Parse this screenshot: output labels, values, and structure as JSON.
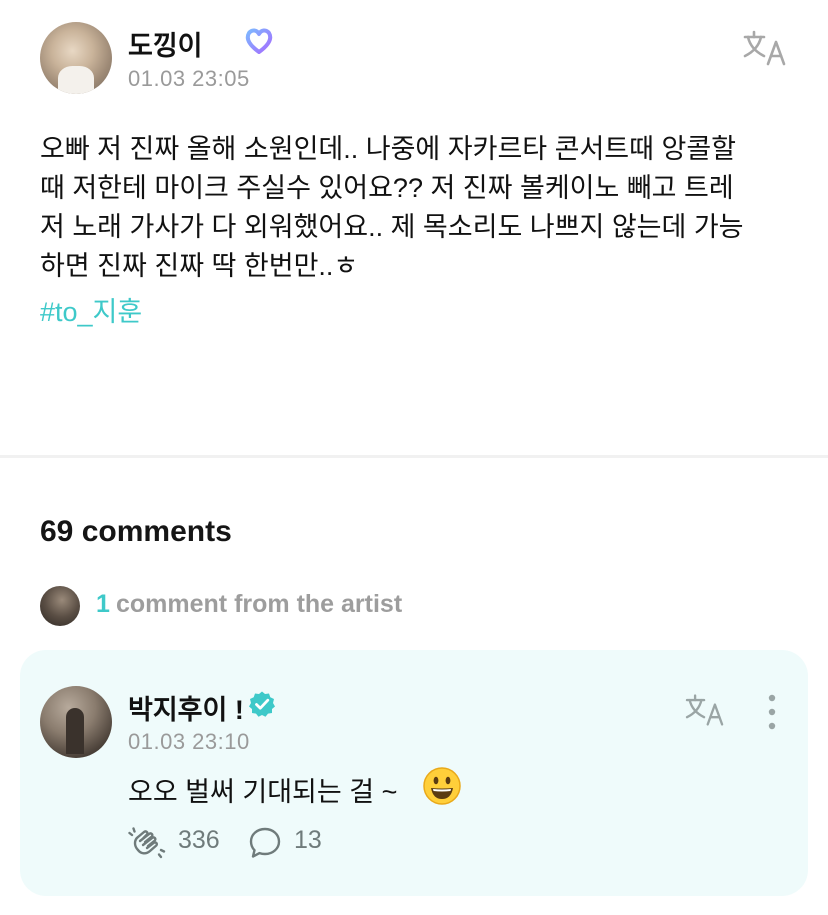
{
  "post": {
    "author": "도낑이",
    "time": "01.03 23:05",
    "body": "오빠 저 진짜 올해 소원인데.. 나중에 자카르타 콘서트때 앙콜할\n때 저한테 마이크 주실수 있어요?? 저 진짜 볼케이노 빼고 트레\n저 노래 가사가 다 외워했어요.. 제 목소리도 나쁘지 않는데 가능\n하면 진짜 진짜 딱 한번만..ㅎ",
    "hashtag": "#to_지훈"
  },
  "comments": {
    "header": "69 comments",
    "artist_count": "1",
    "artist_text": "comment from the artist"
  },
  "artist_comment": {
    "name": "박지후이 !",
    "time": "01.03 23:10",
    "text": "오오 벌써 기대되는 걸 ~",
    "likes": "336",
    "replies": "13"
  },
  "icons": {
    "fan_badge": "heart-badge-icon",
    "verified": "verified-check-icon",
    "translate": "translate-icon",
    "more": "more-vertical-icon",
    "like": "applause-icon",
    "reply": "speech-bubble-icon",
    "emoji": "smiling-face-emoji"
  },
  "colors": {
    "accent": "#3ec9c9",
    "card_bg": "#effbfb",
    "muted": "#9a9a9a"
  }
}
